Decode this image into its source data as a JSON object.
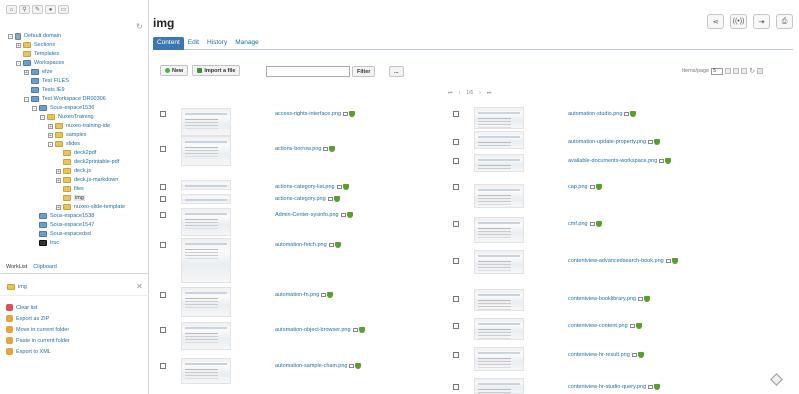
{
  "sidebar": {
    "tree": [
      {
        "label": "Default domain",
        "level": 0,
        "kind": "domain",
        "toggle": "-"
      },
      {
        "label": "Sections",
        "level": 1,
        "kind": "folder",
        "toggle": "+"
      },
      {
        "label": "Templates",
        "level": 1,
        "kind": "folder",
        "toggle": ""
      },
      {
        "label": "Workspaces",
        "level": 1,
        "kind": "blue",
        "toggle": "-"
      },
      {
        "label": "efze",
        "level": 2,
        "kind": "blue",
        "toggle": "+"
      },
      {
        "label": "Test FILES",
        "level": 2,
        "kind": "blue",
        "toggle": ""
      },
      {
        "label": "Tests IE9",
        "level": 2,
        "kind": "blue",
        "toggle": ""
      },
      {
        "label": "Test Workspace DR00306",
        "level": 2,
        "kind": "blue",
        "toggle": "-"
      },
      {
        "label": "Sous-espace1536",
        "level": 3,
        "kind": "blue",
        "toggle": "-"
      },
      {
        "label": "NuxeoTraining",
        "level": 4,
        "kind": "folder",
        "toggle": "-"
      },
      {
        "label": "nuxeo-training-ide",
        "level": 5,
        "kind": "folder",
        "toggle": "+"
      },
      {
        "label": "samples",
        "level": 5,
        "kind": "folder",
        "toggle": "+"
      },
      {
        "label": "slides",
        "level": 5,
        "kind": "folder",
        "toggle": "-"
      },
      {
        "label": "deck2pdf",
        "level": 6,
        "kind": "folder",
        "toggle": ""
      },
      {
        "label": "deck2printable-pdf",
        "level": 6,
        "kind": "folder",
        "toggle": ""
      },
      {
        "label": "deck.js",
        "level": 6,
        "kind": "folder",
        "toggle": "+"
      },
      {
        "label": "deck.js-markdown",
        "level": 6,
        "kind": "folder",
        "toggle": "+"
      },
      {
        "label": "files",
        "level": 6,
        "kind": "folder",
        "toggle": ""
      },
      {
        "label": "img",
        "level": 6,
        "kind": "folder",
        "toggle": "",
        "selected": true
      },
      {
        "label": "nuxeo-slide-template",
        "level": 6,
        "kind": "folder",
        "toggle": "+"
      },
      {
        "label": "Sous-espace1538",
        "level": 3,
        "kind": "blue",
        "toggle": ""
      },
      {
        "label": "Sous-espace1547",
        "level": 3,
        "kind": "blue",
        "toggle": ""
      },
      {
        "label": "Sous-espacedsd",
        "level": 3,
        "kind": "blue",
        "toggle": ""
      },
      {
        "label": "truc",
        "level": 3,
        "kind": "trash",
        "toggle": ""
      }
    ],
    "worklist_tabs": [
      "WorkList",
      "Clipboard"
    ],
    "worklist_item": "img",
    "actions": [
      {
        "label": "Clear list",
        "color": "#d9534f"
      },
      {
        "label": "Export as ZIP",
        "color": "#e8a33a"
      },
      {
        "label": "Move in current folder",
        "color": "#e8a33a"
      },
      {
        "label": "Paste in current folder",
        "color": "#e8a33a"
      },
      {
        "label": "Export to XML",
        "color": "#e8a33a"
      }
    ]
  },
  "header": {
    "title": "img",
    "tabs": [
      "Content",
      "Edit",
      "History",
      "Manage"
    ],
    "active_tab": "Content"
  },
  "toolbar": {
    "new_label": "New",
    "import_label": "Import a file",
    "filter_label": "Filter",
    "more_label": "...",
    "search_value": "",
    "items_per_page_label": "Items/page",
    "items_per_page_value": "5",
    "page_indicator": "1/6"
  },
  "left_files": [
    "access-rights-interface.png",
    "actions-borrow.png",
    "actions-category-list.png",
    "actions-category.png",
    "Admin-Center-sysinfo.png",
    "automation-fetch.png",
    "automation-fn.png",
    "automation-object-browser.png",
    "automation-sample-chain.png"
  ],
  "right_files": [
    "automation-studio.png",
    "automation-update-property.png",
    "available-documents-workspace.png",
    "cap.png",
    "cmf.png",
    "contentview-advancedsearch-book.png",
    "contentview-booklibrary.png",
    "contentview-content.png",
    "contentview-hr-result.png",
    "contentview-hr-studio-query.png"
  ],
  "colors": {
    "accent": "#3c76b3",
    "link": "#1f6fa8"
  }
}
